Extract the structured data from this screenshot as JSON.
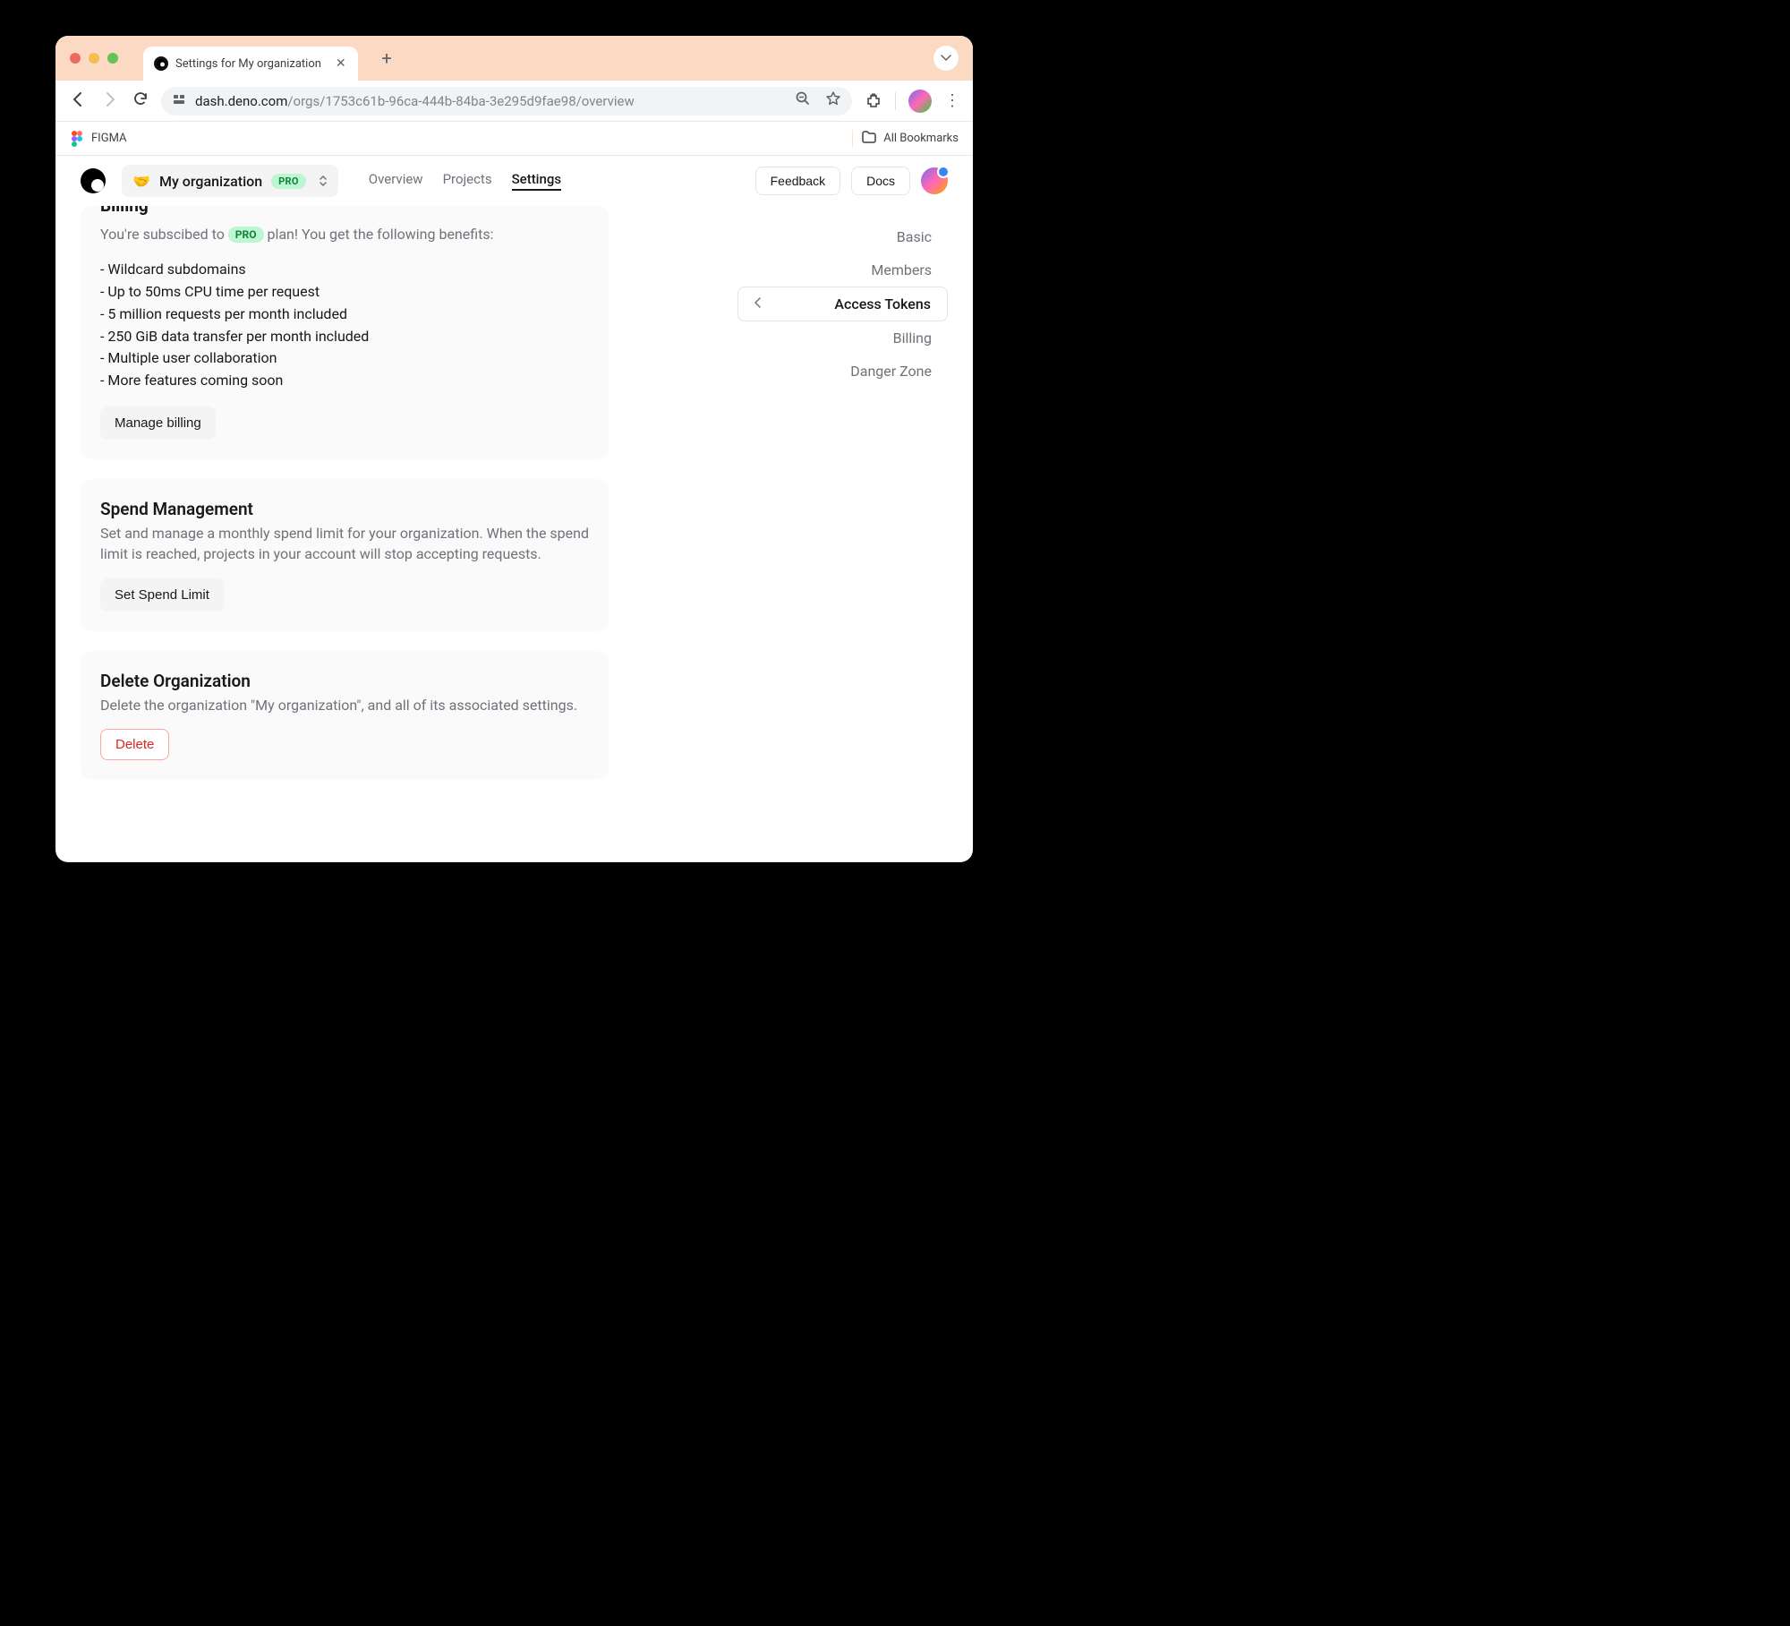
{
  "browser": {
    "tab_title": "Settings for My organization",
    "url_host": "dash.deno.com",
    "url_path": "/orgs/1753c61b-96ca-444b-84ba-3e295d9fae98/overview",
    "bookmark_figma": "FIGMA",
    "all_bookmarks": "All Bookmarks"
  },
  "header": {
    "org_name": "My organization",
    "pro_badge": "PRO",
    "tabs": {
      "overview": "Overview",
      "projects": "Projects",
      "settings": "Settings"
    },
    "feedback": "Feedback",
    "docs": "Docs"
  },
  "sidebar": {
    "basic": "Basic",
    "members": "Members",
    "access_tokens": "Access Tokens",
    "billing": "Billing",
    "danger_zone": "Danger Zone"
  },
  "billing": {
    "title": "Billing",
    "desc_pre": "You're subscibed to ",
    "desc_badge": "PRO",
    "desc_post": " plan! You get the following benefits:",
    "benefits": [
      "- Wildcard subdomains",
      "- Up to 50ms CPU time per request",
      "- 5 million requests per month included",
      "- 250 GiB data transfer per month included",
      "- Multiple user collaboration",
      "- More features coming soon"
    ],
    "manage_btn": "Manage billing"
  },
  "spend": {
    "title": "Spend Management",
    "desc": "Set and manage a monthly spend limit for your organization. When the spend limit is reached, projects in your account will stop accepting requests.",
    "btn": "Set Spend Limit"
  },
  "delete_org": {
    "title": "Delete Organization",
    "desc": "Delete the organization \"My organization\", and all of its associated settings.",
    "btn": "Delete"
  }
}
